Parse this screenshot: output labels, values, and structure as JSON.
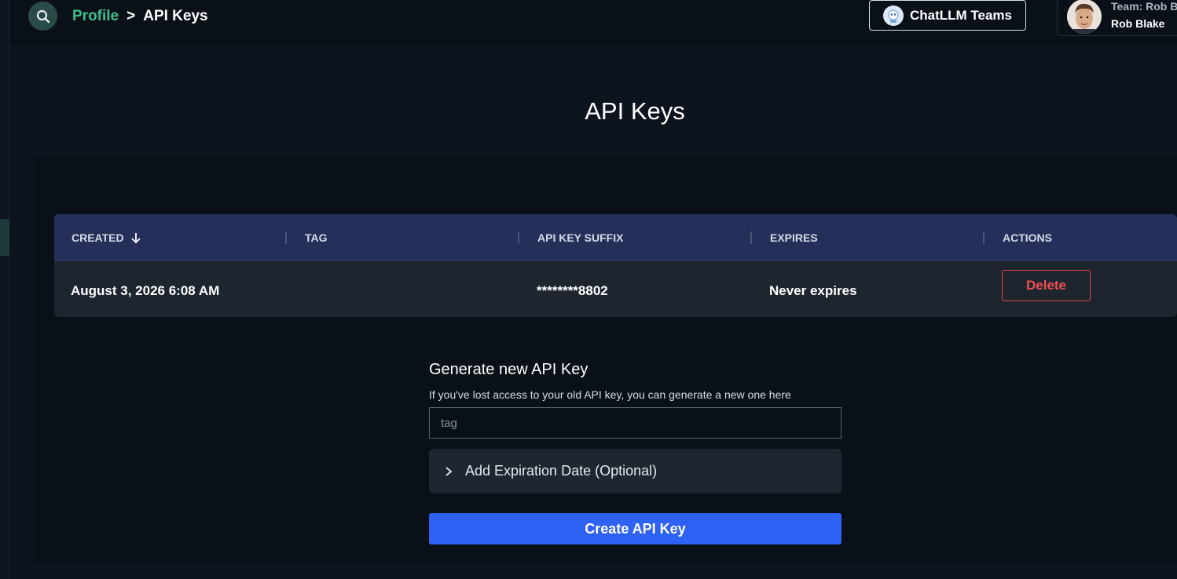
{
  "header": {
    "breadcrumb": {
      "profile": "Profile",
      "separator": ">",
      "current": "API Keys"
    },
    "teams_button": "ChatLLM Teams",
    "user": {
      "team_label": "Team: Rob B",
      "name": "Rob Blake"
    }
  },
  "page": {
    "title": "API Keys"
  },
  "table": {
    "columns": [
      "CREATED",
      "TAG",
      "API KEY SUFFIX",
      "EXPIRES",
      "ACTIONS"
    ],
    "rows": [
      {
        "created": "August 3, 2026 6:08 AM",
        "tag": "",
        "suffix": "********8802",
        "expires": "Never expires",
        "action": "Delete"
      }
    ]
  },
  "generate": {
    "title": "Generate new API Key",
    "subtitle": "If you've lost access to your old API key, you can generate a new one here",
    "tag_placeholder": "tag",
    "expiration_label": "Add Expiration Date (Optional)",
    "create_button": "Create API Key"
  },
  "colors": {
    "accent_green": "#3fbf90",
    "header_row": "#24305a",
    "danger": "#e04545",
    "primary": "#2e62f5"
  }
}
